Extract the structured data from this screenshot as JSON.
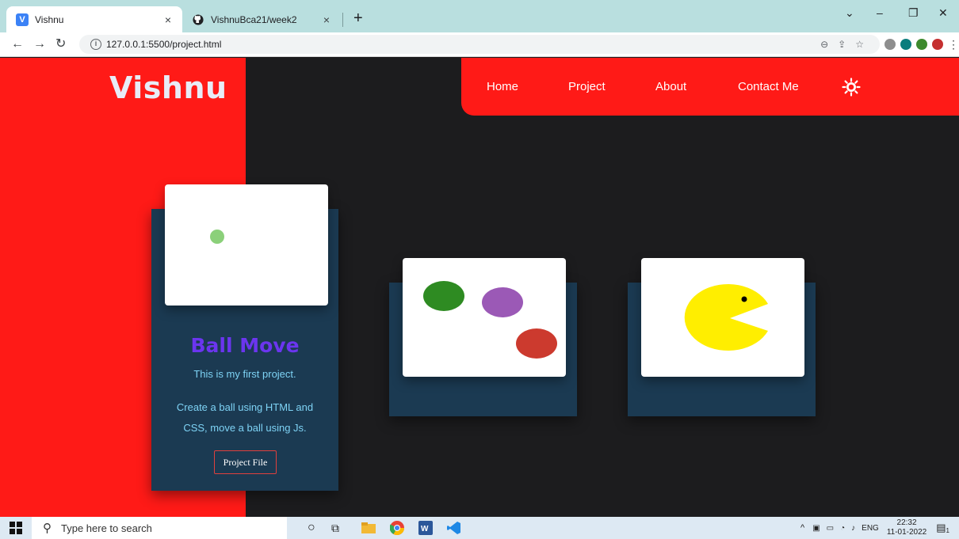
{
  "browser": {
    "tabs": [
      {
        "title": "Vishnu",
        "favicon": "V",
        "active": true
      },
      {
        "title": "VishnuBca21/week2",
        "favicon": "github",
        "active": false
      }
    ],
    "new_tab": "+",
    "close_glyph": "×",
    "url": "127.0.0.1:5500/project.html",
    "window_controls": [
      "⌄",
      "–",
      "❐",
      "✕"
    ]
  },
  "site": {
    "logo": "Vishnu",
    "nav": [
      "Home",
      "Project",
      "About",
      "Contact Me"
    ],
    "theme_toggle_icon": "sun-icon",
    "colors": {
      "accent_red": "#ff1a17",
      "card_bg": "#1b3a52",
      "title_purple": "#6b35ef",
      "text_blue": "#7ed3f5",
      "page_bg": "#1c1c1e"
    }
  },
  "projects": [
    {
      "title": "Ball Move",
      "lines": [
        "This is my first project.",
        "Create a ball using HTML and",
        "CSS, move a ball using Js."
      ],
      "button": "Project File",
      "preview": "single-green-ball"
    },
    {
      "title": "",
      "preview": "three-colored-balls"
    },
    {
      "title": "",
      "preview": "pacman"
    }
  ],
  "taskbar": {
    "search_placeholder": "Type here to search",
    "tray_lang": "ENG",
    "time": "22:32",
    "date": "11-01-2022",
    "notification_count": "1"
  }
}
